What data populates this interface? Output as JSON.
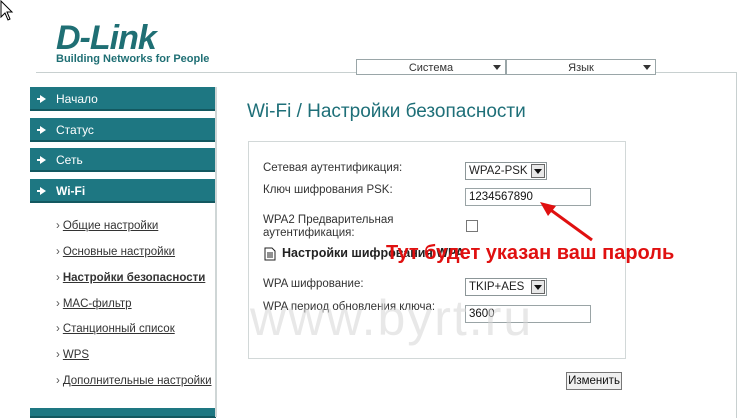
{
  "logo": {
    "main": "D-Link",
    "tagline": "Building Networks for People"
  },
  "top_menu": {
    "system": "Система",
    "language": "Язык"
  },
  "sidebar": {
    "items": [
      {
        "label": "Начало"
      },
      {
        "label": "Статус"
      },
      {
        "label": "Сеть"
      },
      {
        "label": "Wi-Fi"
      }
    ],
    "wifi_sub": [
      {
        "label": "Общие настройки"
      },
      {
        "label": "Основные настройки"
      },
      {
        "label": "Настройки безопасности"
      },
      {
        "label": "MAC-фильтр"
      },
      {
        "label": "Станционный список"
      },
      {
        "label": "WPS"
      },
      {
        "label": "Дополнительные настройки"
      }
    ]
  },
  "page": {
    "title": "Wi-Fi / Настройки безопасности",
    "fields": {
      "auth_label": "Сетевая аутентификация:",
      "auth_value": "WPA2-PSK",
      "psk_label": "Ключ шифрования PSK:",
      "psk_value": "1234567890",
      "preauth_label_1": "WPA2 Предварительная",
      "preauth_label_2": "аутентификация:",
      "section_title": "Настройки шифрования WPA",
      "enc_label": "WPA шифрование:",
      "enc_value": "TKIP+AES",
      "renew_label": "WPA период обновления ключа:",
      "renew_value": "3600"
    },
    "apply_button": "Изменить"
  },
  "annotation": {
    "text": "Тут будет указан ваш пароль",
    "color": "#e01010"
  },
  "watermark": "www.byrt.ru",
  "colors": {
    "accent": "#1e7782",
    "title": "#1e6f78"
  }
}
